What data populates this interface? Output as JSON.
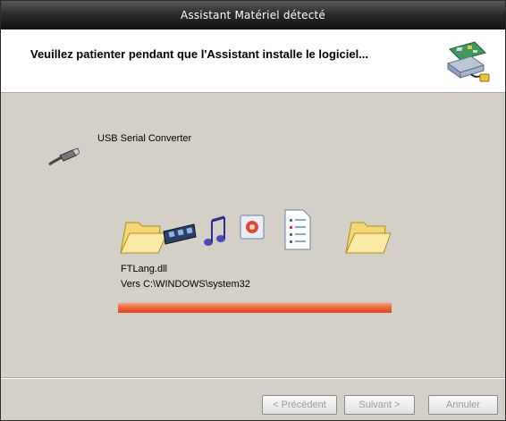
{
  "window": {
    "title": "Assistant Matériel détecté"
  },
  "header": {
    "heading": "Veuillez patienter pendant que l'Assistant installe le logiciel...",
    "icon": "hardware-wizard-icon"
  },
  "device": {
    "icon": "usb-plug-icon",
    "name": "USB Serial Converter"
  },
  "copy": {
    "file": "FTLang.dll",
    "destination": "Vers C:\\WINDOWS\\system32",
    "progress": 1.0,
    "progress_color": "#ee6a37",
    "icons": [
      "folder-icon",
      "film-icon",
      "music-note-icon",
      "image-file-icon",
      "document-icon",
      "folder-icon"
    ]
  },
  "buttons": {
    "back": "< Précédent",
    "next": "Suivant >",
    "cancel": "Annuler"
  }
}
